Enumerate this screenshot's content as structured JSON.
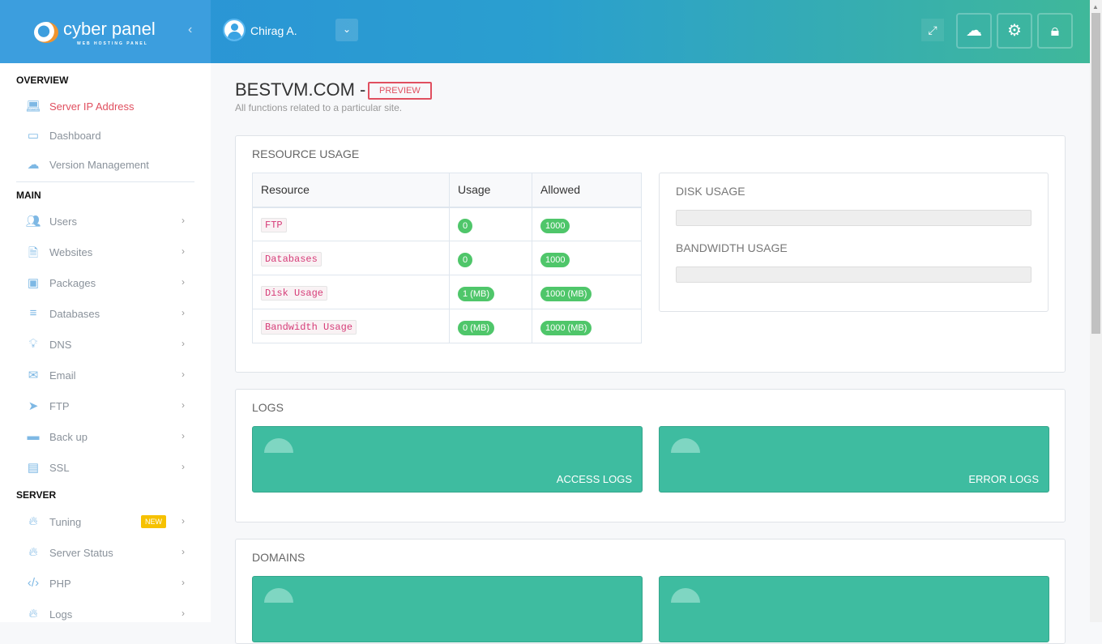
{
  "brand": {
    "name": "cyber panel",
    "tagline": "WEB HOSTING PANEL"
  },
  "user": {
    "name": "Chirag A."
  },
  "sidebar": {
    "sections": [
      "OVERVIEW",
      "MAIN",
      "SERVER"
    ],
    "overview": [
      {
        "label": "Server IP Address",
        "icon": "laptop-icon"
      },
      {
        "label": "Dashboard",
        "icon": "monitor-icon"
      },
      {
        "label": "Version Management",
        "icon": "cloud-upload-icon"
      }
    ],
    "main": [
      {
        "label": "Users"
      },
      {
        "label": "Websites"
      },
      {
        "label": "Packages"
      },
      {
        "label": "Databases"
      },
      {
        "label": "DNS"
      },
      {
        "label": "Email"
      },
      {
        "label": "FTP"
      },
      {
        "label": "Back up"
      },
      {
        "label": "SSL"
      }
    ],
    "server": [
      {
        "label": "Tuning",
        "badge": "NEW"
      },
      {
        "label": "Server Status"
      },
      {
        "label": "PHP"
      },
      {
        "label": "Logs"
      }
    ]
  },
  "page": {
    "title": "BESTVM.COM -",
    "badge": "PREVIEW",
    "subtitle": "All functions related to a particular site."
  },
  "resource": {
    "title": "RESOURCE USAGE",
    "headers": [
      "Resource",
      "Usage",
      "Allowed"
    ],
    "rows": [
      [
        "FTP",
        "0",
        "1000"
      ],
      [
        "Databases",
        "0",
        "1000"
      ],
      [
        "Disk Usage",
        "1 (MB)",
        "1000 (MB)"
      ],
      [
        "Bandwidth Usage",
        "0 (MB)",
        "1000 (MB)"
      ]
    ],
    "disk_label": "DISK USAGE",
    "bandwidth_label": "BANDWIDTH USAGE",
    "disk_percent": 0,
    "bandwidth_percent": 0
  },
  "logs": {
    "title": "LOGS",
    "tiles": [
      "ACCESS LOGS",
      "ERROR LOGS"
    ]
  },
  "domains": {
    "title": "DOMAINS"
  },
  "colors": {
    "accent": "#3ebca0",
    "active": "#e04f5f",
    "badge": "#4fc66a"
  }
}
